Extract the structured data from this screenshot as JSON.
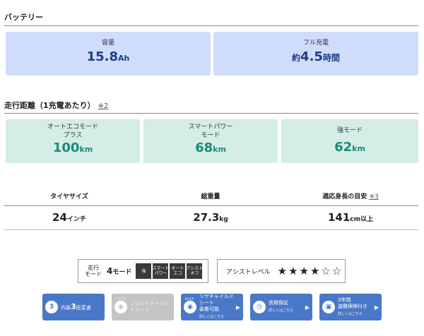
{
  "battery": {
    "title": "バッテリー",
    "capacity": {
      "label": "容量",
      "value": "15.8",
      "unit": "Ah"
    },
    "charge": {
      "label": "フル充電",
      "prefix": "約",
      "value": "4.5",
      "unit": "時間"
    }
  },
  "range": {
    "title": "走行距離（1充電あたり）",
    "note": "※2",
    "modes": [
      {
        "label_line1": "オートエコモード",
        "label_line2": "プラス",
        "value": "100",
        "unit": "km"
      },
      {
        "label_line1": "スマートパワー",
        "label_line2": "モード",
        "value": "68",
        "unit": "km"
      },
      {
        "label_line1": "強モード",
        "label_line2": "",
        "value": "62",
        "unit": "km"
      }
    ]
  },
  "specs": [
    {
      "label": "タイヤサイズ",
      "note": "",
      "value": "24",
      "unit": "インチ"
    },
    {
      "label": "総重量",
      "note": "",
      "value": "27.3",
      "unit": "kg"
    },
    {
      "label": "適応身長の目安",
      "note": "※3",
      "value": "141",
      "unit": "cm以上"
    }
  ],
  "mode_box": {
    "label_line1": "走行",
    "label_line2": "モード",
    "count": "4",
    "count_unit": "モード",
    "chips": [
      "強",
      "スマート\nパワー",
      "オート\nエコ",
      "アシスト\nオフ"
    ]
  },
  "assist": {
    "label": "アシストレベル",
    "stars": "★★★★☆☆",
    "rating": 4,
    "max": 6
  },
  "features": [
    {
      "icon": "3",
      "text_pre": "内装",
      "text_num": "3",
      "text_post": "段変速",
      "sub": "",
      "tag": "",
      "style": "blue"
    },
    {
      "icon": "",
      "text_pre": "フロントチャイルドシート",
      "text_num": "",
      "text_post": "",
      "sub": "",
      "tag": "FRONT",
      "style": "gray"
    },
    {
      "icon": "",
      "text_pre": "リヤチャイルドシート",
      "text_num": "",
      "text_post": "装着可能",
      "sub": "詳しくはこちら",
      "tag": "REAR",
      "style": "blue"
    },
    {
      "icon": "",
      "text_pre": "長期保証",
      "text_num": "",
      "text_post": "",
      "sub": "詳しくはこちら",
      "tag": "",
      "style": "blue"
    },
    {
      "icon": "",
      "text_pre": "3年間",
      "text_num": "",
      "text_post": "盗難保険付き",
      "sub": "詳しくはこちら",
      "tag": "",
      "style": "blue"
    }
  ],
  "colors": {
    "blue_card": "#cfdcfb",
    "green_card": "#d4ede6",
    "blue_text": "#1f3c87",
    "green_text": "#1a8a7a",
    "feature_blue": "#4a78c8"
  }
}
